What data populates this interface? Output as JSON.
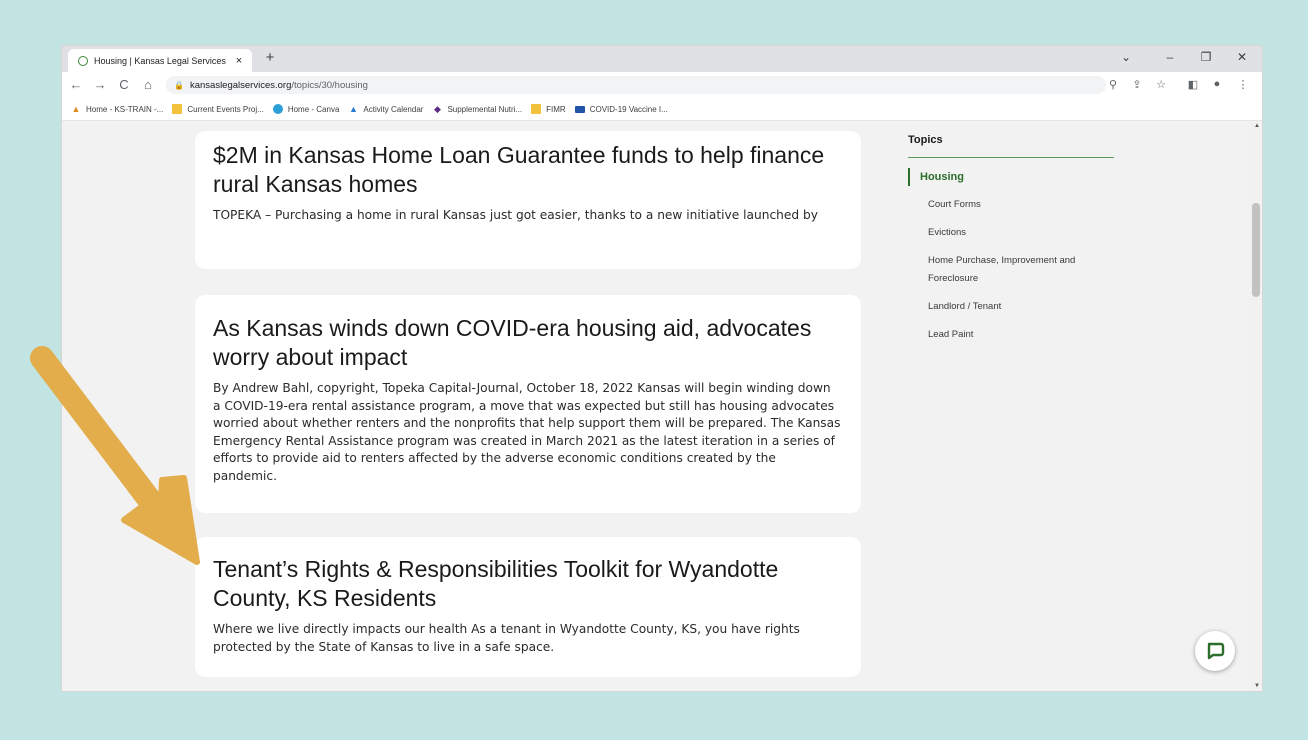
{
  "browser": {
    "tab_title": "Housing | Kansas Legal Services",
    "tab_close": "×",
    "new_tab": "+",
    "url_domain": "kansaslegalservices.org",
    "url_path": "/topics/30/housing",
    "window_controls": {
      "dropdown": "⌄",
      "minimize": "–",
      "maximize": "❐",
      "close": "✕"
    },
    "nav": {
      "back": "←",
      "forward": "→",
      "reload": "C",
      "home": "⌂"
    },
    "toolbar_icons": {
      "zoom": "⚲",
      "share": "⇪",
      "star": "☆",
      "sidebar": "◧",
      "profile": "●",
      "menu": "⋮"
    },
    "bookmarks": [
      {
        "label": "Home - KS-TRAIN -...",
        "icon": "ks-train-icon"
      },
      {
        "label": "Current Events Proj...",
        "icon": "folder-icon"
      },
      {
        "label": "Home - Canva",
        "icon": "canva-icon"
      },
      {
        "label": "Activity Calendar",
        "icon": "ks-train-icon"
      },
      {
        "label": "Supplemental Nutri...",
        "icon": "k-state-icon"
      },
      {
        "label": "FIMR",
        "icon": "folder-icon"
      },
      {
        "label": "COVID-19 Vaccine I...",
        "icon": "vaccine-icon"
      }
    ]
  },
  "articles": [
    {
      "title": "$2M in Kansas Home Loan Guarantee funds to help finance rural Kansas homes",
      "summary": "TOPEKA – Purchasing a home in rural Kansas just got easier, thanks to a new initiative launched by"
    },
    {
      "title": "As Kansas winds down COVID-era housing aid, advocates worry about impact",
      "summary": "By Andrew Bahl, copyright, Topeka Capital-Journal, October 18, 2022 Kansas will begin winding down a COVID-19-era rental assistance program, a move that was expected but still has housing advocates worried about whether renters and the nonprofits that help support them will be prepared. The Kansas Emergency Rental Assistance program was created in March 2021 as the latest iteration in a series of efforts to provide aid to renters affected by the adverse economic conditions created by the pandemic."
    },
    {
      "title": "Tenant’s Rights & Responsibilities Toolkit for Wyandotte County, KS Residents",
      "summary": "Where we live directly impacts our health As a tenant in Wyandotte County, KS, you have rights protected by the State of Kansas to live in a safe space."
    }
  ],
  "sidebar": {
    "title": "Topics",
    "current": "Housing",
    "links": [
      "Court Forms",
      "Evictions",
      "Home Purchase, Improvement and Foreclosure",
      "Landlord / Tenant",
      "Lead Paint"
    ]
  },
  "colors": {
    "background": "#c2e4e3",
    "accent_green": "#2c6e2c",
    "arrow": "#e2ad4a"
  }
}
